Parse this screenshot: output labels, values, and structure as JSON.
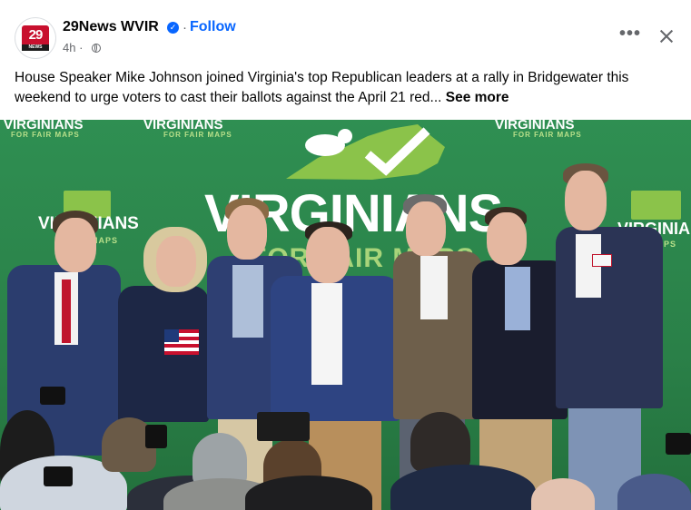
{
  "post": {
    "page_name": "29News WVIR",
    "follow_label": "Follow",
    "separator": "·",
    "time_ago": "4h ·",
    "avatar_logo_text": "29",
    "avatar_logo_subtext": "NEWS",
    "more_label": "•••",
    "caption": "House Speaker Mike Johnson joined Virginia's top Republican leaders at a rally in Bridgewater this weekend to urge voters to cast their ballots against the April 21 red... ",
    "see_more_label": "See more"
  },
  "photo": {
    "backdrop_main_title": "VIRGINIANS",
    "backdrop_main_subtitle": "FOR FAIR MAPS",
    "backdrop_band_left": "VIRGINIANS",
    "backdrop_band_center": "VIRGINIANS",
    "backdrop_band_right": "VIRGINIANS",
    "backdrop_band_sub": "FOR FAIR MAPS",
    "backdrop_side_left": "VIRGINIANS",
    "backdrop_side_left_sub": "MAPS",
    "backdrop_side_right": "VIRGINIANS",
    "backdrop_side_right_sub": "MAPS",
    "icons": {
      "verified": "verified-badge-icon",
      "globe": "globe-icon",
      "close": "close-icon",
      "more": "more-options-icon"
    },
    "colors": {
      "backdrop_green": "#2f8f52",
      "logo_green": "#8bc34a",
      "follow_blue": "#0866ff"
    }
  }
}
